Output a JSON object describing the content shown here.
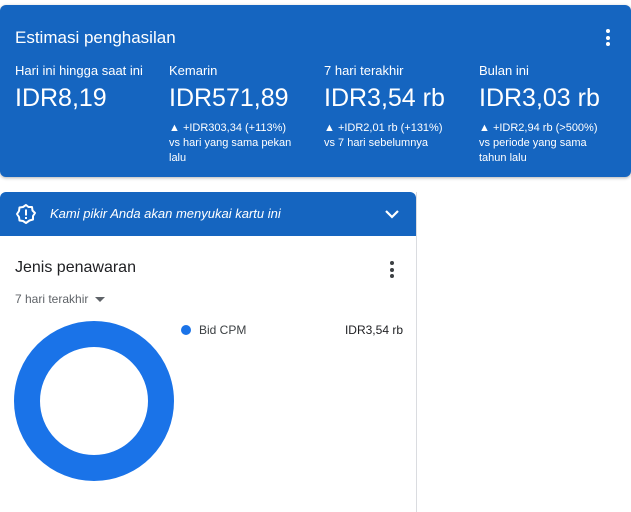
{
  "summary": {
    "title": "Estimasi penghasilan",
    "metrics": [
      {
        "label": "Hari ini hingga saat ini",
        "value": "IDR8,19",
        "change": "",
        "compare": ""
      },
      {
        "label": "Kemarin",
        "value": "IDR571,89",
        "change": "▲ +IDR303,34 (+113%)",
        "compare": "vs hari yang sama pekan lalu"
      },
      {
        "label": "7 hari terakhir",
        "value": "IDR3,54 rb",
        "change": "▲ +IDR2,01 rb (+131%)",
        "compare": "vs 7 hari sebelumnya"
      },
      {
        "label": "Bulan ini",
        "value": "IDR3,03 rb",
        "change": "▲ +IDR2,94 rb (>500%)",
        "compare": "vs periode yang sama tahun lalu"
      }
    ]
  },
  "suggestion": {
    "text": "Kami pikir Anda akan menyukai kartu ini",
    "icon": "badge-alert-icon"
  },
  "bid_card": {
    "title": "Jenis penawaran",
    "range": "7 hari terakhir",
    "items": [
      {
        "label": "Bid CPM",
        "value": "IDR3,54 rb",
        "share": 1.0,
        "color": "#1a73e8"
      }
    ]
  },
  "colors": {
    "primary": "#1565c0",
    "series": "#1a73e8"
  }
}
